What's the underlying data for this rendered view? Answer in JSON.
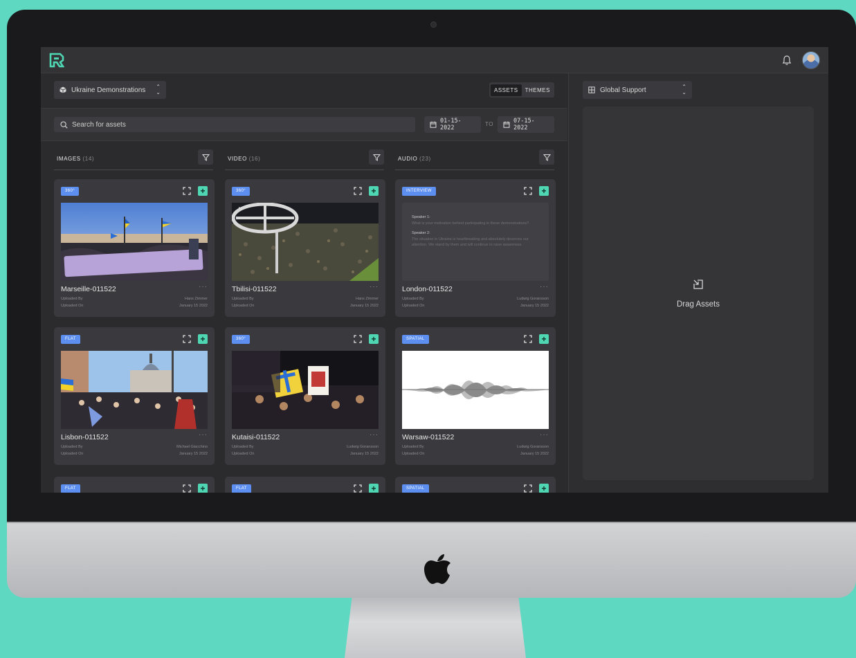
{
  "project": {
    "name": "Ukraine Demonstrations"
  },
  "view_toggle": {
    "assets": "ASSETS",
    "themes": "THEMES",
    "active": "ASSETS"
  },
  "search": {
    "placeholder": "Search for assets"
  },
  "date_range": {
    "from": "01-15-2022",
    "to_label": "TO",
    "to": "07-15-2022"
  },
  "columns": [
    {
      "title": "IMAGES",
      "count": "(14)"
    },
    {
      "title": "VIDEO",
      "count": "(16)"
    },
    {
      "title": "AUDIO",
      "count": "(23)"
    }
  ],
  "cards": [
    {
      "tag": "360°",
      "name": "Marseille-011522",
      "uploaded_by_label": "Uploaded By",
      "uploaded_by": "Hans Zimmer",
      "uploaded_on_label": "Uploaded On",
      "uploaded_on": "January 15 2022"
    },
    {
      "tag": "360°",
      "name": "Tbilisi-011522",
      "uploaded_by_label": "Uploaded By",
      "uploaded_by": "Hans Zimmer",
      "uploaded_on_label": "Uploaded On",
      "uploaded_on": "January 15 2022"
    },
    {
      "tag": "INTERVIEW",
      "name": "London-011522",
      "uploaded_by_label": "Uploaded By",
      "uploaded_by": "Ludwig Goransson",
      "uploaded_on_label": "Uploaded On",
      "uploaded_on": "January 15 2022",
      "transcript": [
        {
          "speaker": "Speaker 1:",
          "text": "What is your motivation behind participating in these demonstrations?"
        },
        {
          "speaker": "Speaker 2:",
          "text": "The situation in Ukraine is heartbreaking and absolutely deserves our attention. We stand by them and will continue to raise awareness."
        }
      ]
    },
    {
      "tag": "FLAT",
      "name": "Lisbon-011522",
      "uploaded_by_label": "Uploaded By",
      "uploaded_by": "Michael Giacchino",
      "uploaded_on_label": "Uploaded On",
      "uploaded_on": "January 15 2022"
    },
    {
      "tag": "360°",
      "name": "Kutaisi-011522",
      "uploaded_by_label": "Uploaded By",
      "uploaded_by": "Ludwig Goransson",
      "uploaded_on_label": "Uploaded On",
      "uploaded_on": "January 15 2022"
    },
    {
      "tag": "SPATIAL",
      "name": "Warsaw-011522",
      "uploaded_by_label": "Uploaded By",
      "uploaded_by": "Ludwig Goransson",
      "uploaded_on_label": "Uploaded On",
      "uploaded_on": "January 15 2022"
    },
    {
      "tag": "FLAT"
    },
    {
      "tag": "FLAT"
    },
    {
      "tag": "SPATIAL"
    }
  ],
  "right_panel": {
    "workspace": "Global Support",
    "drop_label": "Drag Assets"
  },
  "colors": {
    "accent": "#4fd7b4",
    "tag": "#5d8ff0",
    "background": "#5fd8c2"
  },
  "icons": [
    "logo-icon",
    "bell-icon",
    "avatar",
    "cube-icon",
    "search-icon",
    "calendar-icon",
    "filter-icon",
    "expand-icon",
    "plus-icon",
    "more-icon",
    "grid-icon",
    "drag-icon",
    "apple-logo"
  ]
}
